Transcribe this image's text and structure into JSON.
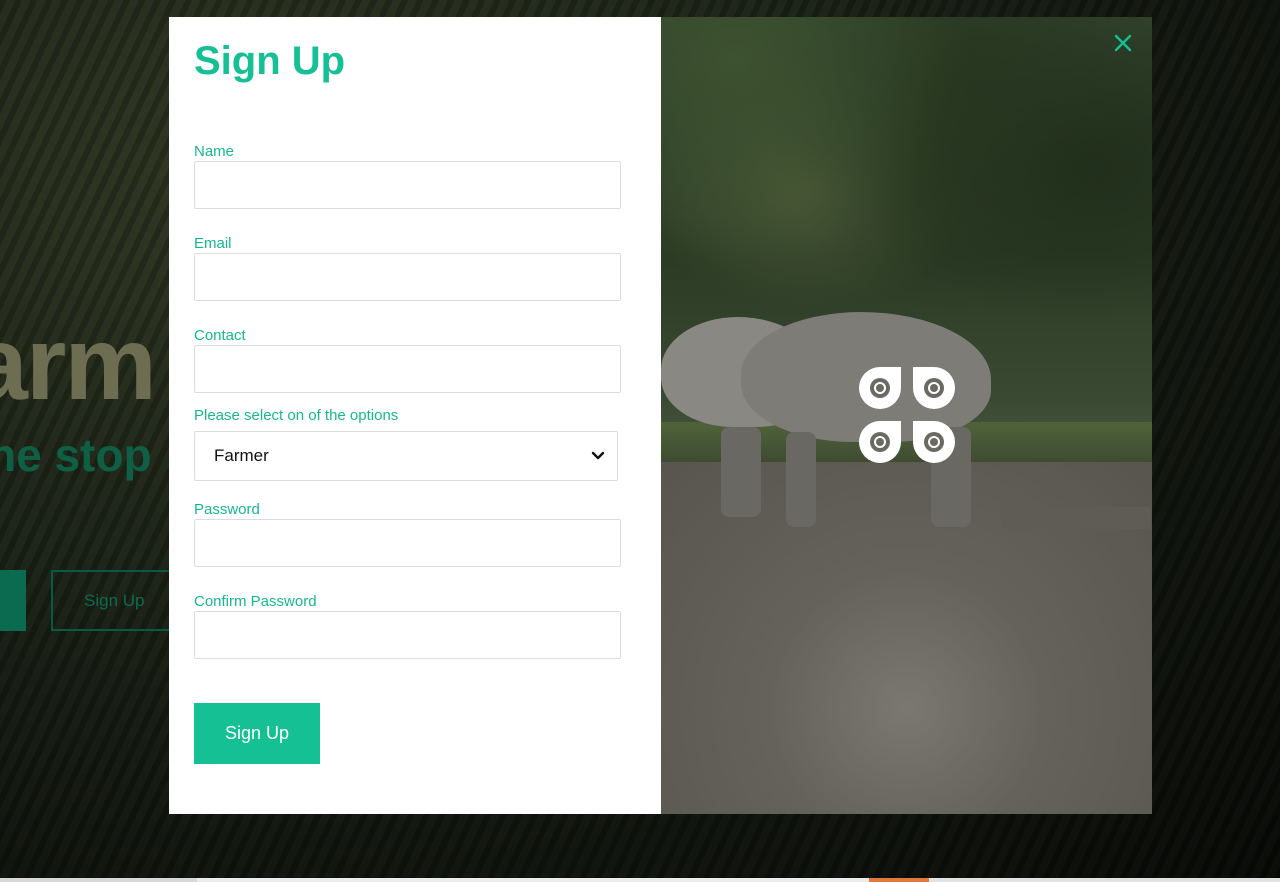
{
  "background": {
    "hero_title": "arm",
    "hero_subtitle": "ne stop",
    "signup_button": "Sign Up"
  },
  "modal": {
    "title": "Sign Up",
    "fields": {
      "name": {
        "label": "Name",
        "value": ""
      },
      "email": {
        "label": "Email",
        "value": ""
      },
      "contact": {
        "label": "Contact",
        "value": ""
      },
      "role": {
        "label": "Please select on of the options",
        "selected": "Farmer"
      },
      "password": {
        "label": "Password",
        "value": ""
      },
      "confirm_password": {
        "label": "Confirm Password",
        "value": ""
      }
    },
    "submit_label": "Sign Up",
    "close_icon": "close-icon",
    "logo_icon": "app-logo-icon"
  },
  "colors": {
    "accent": "#16c095",
    "label": "#16b88e",
    "hero_subtitle": "#17936a",
    "hero_title": "#a8a87f"
  }
}
